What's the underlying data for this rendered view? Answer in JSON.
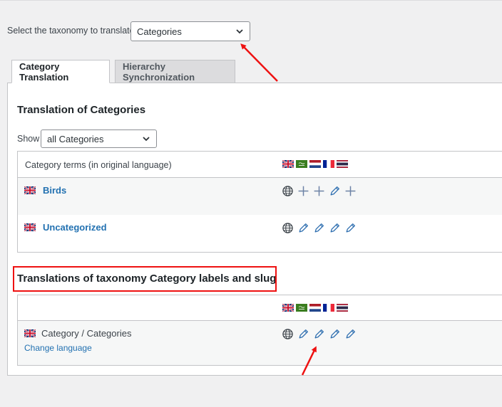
{
  "taxonomy_selector": {
    "label": "Select the taxonomy to translate:",
    "value": "Categories"
  },
  "tabs": [
    {
      "label": "Category Translation",
      "active": true
    },
    {
      "label": "Hierarchy Synchronization",
      "active": false
    }
  ],
  "translation_section": {
    "title": "Translation of Categories",
    "show_label": "Show",
    "show_value": "all Categories",
    "column_header": "Category terms (in original language)",
    "language_flags": [
      "en",
      "ar",
      "nl",
      "fr",
      "th"
    ],
    "rows": [
      {
        "flag": "en",
        "name": "Birds",
        "actions": [
          "globe-icon",
          "plus-icon",
          "plus-icon",
          "pencil-icon",
          "plus-icon"
        ]
      },
      {
        "flag": "en",
        "name": "Uncategorized",
        "actions": [
          "globe-icon",
          "pencil-icon",
          "pencil-icon",
          "pencil-icon",
          "pencil-icon"
        ]
      }
    ]
  },
  "labels_section": {
    "title": "Translations of taxonomy Category labels and slug",
    "language_flags": [
      "en",
      "ar",
      "nl",
      "fr",
      "th"
    ],
    "row": {
      "flag": "en",
      "name": "Category / Categories",
      "change_language": "Change language",
      "actions": [
        "globe-icon",
        "pencil-icon",
        "pencil-icon",
        "pencil-icon",
        "pencil-icon"
      ]
    }
  },
  "colors": {
    "link": "#2271b1",
    "highlight": "#ee1111",
    "panel_bg": "#ffffff",
    "page_bg": "#f0f0f1"
  }
}
